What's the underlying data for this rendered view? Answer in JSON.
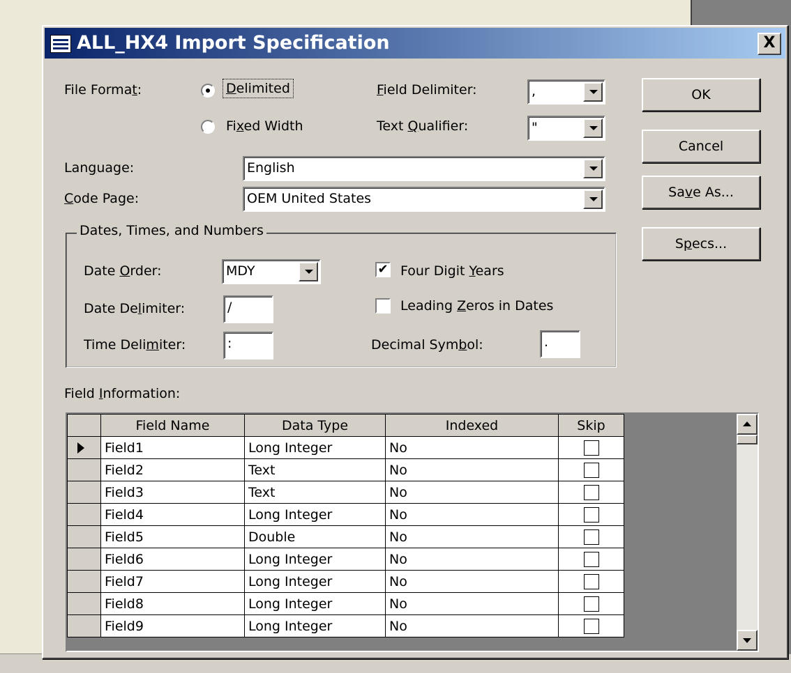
{
  "dialog": {
    "title": "ALL_HX4 Import Specification",
    "close_label": "X"
  },
  "file_format": {
    "label_pre": "File Forma",
    "label_key": "t",
    "label_post": ":",
    "options": [
      {
        "pre": "",
        "key": "D",
        "post": "elimited",
        "selected": true
      },
      {
        "pre": "Fi",
        "key": "x",
        "post": "ed Width",
        "selected": false
      }
    ]
  },
  "field_delimiter": {
    "label_pre": "",
    "label_key": "F",
    "label_post": "ield Delimiter:",
    "value": ","
  },
  "text_qualifier": {
    "label_pre": "Text ",
    "label_key": "Q",
    "label_post": "ualifier:",
    "value": "\""
  },
  "language": {
    "label_pre": "Lan",
    "label_key": "g",
    "label_post": "uage:",
    "value": "English"
  },
  "code_page": {
    "label_pre": "",
    "label_key": "C",
    "label_post": "ode Page:",
    "value": "OEM United States"
  },
  "dtn": {
    "legend": "Dates, Times, and Numbers",
    "date_order": {
      "label_pre": "Date ",
      "label_key": "O",
      "label_post": "rder:",
      "value": "MDY"
    },
    "date_delimiter": {
      "label_pre": "Date De",
      "label_key": "l",
      "label_post": "imiter:",
      "value": "/"
    },
    "time_delimiter": {
      "label_pre": "Time Deli",
      "label_key": "m",
      "label_post": "iter:",
      "value": ":"
    },
    "four_digit_years": {
      "label_pre": "Four Digit ",
      "label_key": "Y",
      "label_post": "ears",
      "checked": true,
      "mark": "✔"
    },
    "leading_zeros": {
      "label_pre": "Leading ",
      "label_key": "Z",
      "label_post": "eros in Dates",
      "checked": false,
      "mark": ""
    },
    "decimal_symbol": {
      "label_pre": "Decimal Sym",
      "label_key": "b",
      "label_post": "ol:",
      "value": "."
    }
  },
  "buttons": {
    "ok": {
      "pre": "OK",
      "key": "",
      "post": ""
    },
    "cancel": {
      "pre": "Cancel",
      "key": "",
      "post": ""
    },
    "save_as": {
      "pre": "Sa",
      "key": "v",
      "post": "e As..."
    },
    "specs": {
      "pre": "S",
      "key": "p",
      "post": "ecs..."
    }
  },
  "field_info": {
    "label_pre": "Field ",
    "label_key": "I",
    "label_post": "nformation:",
    "columns": [
      "Field Name",
      "Data Type",
      "Indexed",
      "Skip"
    ],
    "rows": [
      {
        "name": "Field1",
        "type": "Long Integer",
        "indexed": "No"
      },
      {
        "name": "Field2",
        "type": "Text",
        "indexed": "No"
      },
      {
        "name": "Field3",
        "type": "Text",
        "indexed": "No"
      },
      {
        "name": "Field4",
        "type": "Long Integer",
        "indexed": "No"
      },
      {
        "name": "Field5",
        "type": "Double",
        "indexed": "No"
      },
      {
        "name": "Field6",
        "type": "Long Integer",
        "indexed": "No"
      },
      {
        "name": "Field7",
        "type": "Long Integer",
        "indexed": "No"
      },
      {
        "name": "Field8",
        "type": "Long Integer",
        "indexed": "No"
      },
      {
        "name": "Field9",
        "type": "Long Integer",
        "indexed": "No"
      }
    ]
  }
}
